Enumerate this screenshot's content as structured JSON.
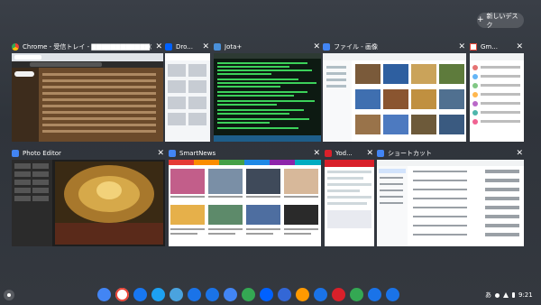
{
  "desk_button": {
    "label": "新しいデスク",
    "plus": "+"
  },
  "windows": [
    {
      "title": "Chrome - 受信トレイ - ▇▇▇▇▇▇▇▇▇▇▇▇@...",
      "icon": "chrome-icon",
      "color": "#4285f4"
    },
    {
      "title": "Dro...",
      "icon": "dropbox-icon",
      "color": "#0061ff"
    },
    {
      "title": "Jota+",
      "icon": "jota-icon",
      "color": "#4a90d9"
    },
    {
      "title": "ファイル - 画像",
      "icon": "files-icon",
      "color": "#4285f4"
    },
    {
      "title": "Gm...",
      "icon": "gmail-icon",
      "color": "#ea4335"
    },
    {
      "title": "Photo Editor",
      "icon": "photo-editor-icon",
      "color": "#4285f4"
    },
    {
      "title": "SmartNews",
      "icon": "smartnews-icon",
      "color": "#4285f4"
    },
    {
      "title": "Yod...",
      "icon": "yodobashi-icon",
      "color": "#d9202a"
    },
    {
      "title": "ショートカット",
      "icon": "shortcut-icon",
      "color": "#4285f4"
    }
  ],
  "shelf": {
    "apps": [
      {
        "name": "chrome",
        "color": "#4285f4"
      },
      {
        "name": "gmail",
        "color": "#ffffff"
      },
      {
        "name": "messenger",
        "color": "#1877f2"
      },
      {
        "name": "twitter",
        "color": "#1da1f2"
      },
      {
        "name": "photos-editor",
        "color": "#4aa3df"
      },
      {
        "name": "camera",
        "color": "#1a73e8"
      },
      {
        "name": "files",
        "color": "#1a73e8"
      },
      {
        "name": "docs",
        "color": "#4285f4"
      },
      {
        "name": "drive",
        "color": "#34a853"
      },
      {
        "name": "dropbox",
        "color": "#0061ff"
      },
      {
        "name": "settings-circle",
        "color": "#3367d6"
      },
      {
        "name": "amazon",
        "color": "#ff9900"
      },
      {
        "name": "bookmark",
        "color": "#1a73e8"
      },
      {
        "name": "yodobashi",
        "color": "#d9202a"
      },
      {
        "name": "photos",
        "color": "#34a853"
      },
      {
        "name": "settings",
        "color": "#1a73e8"
      },
      {
        "name": "keyboard-shortcuts",
        "color": "#1a73e8"
      }
    ],
    "ime": "あ",
    "time": "9:21"
  }
}
